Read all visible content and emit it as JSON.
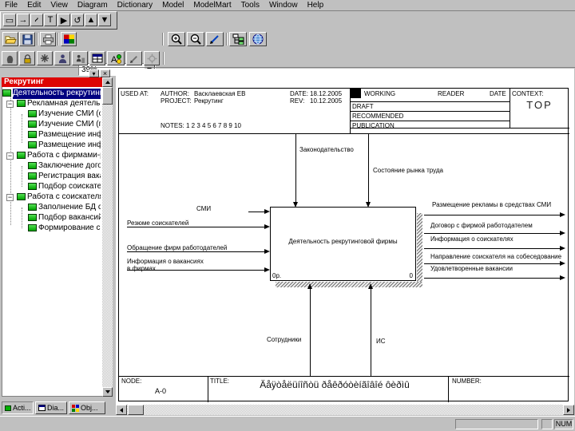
{
  "menu": {
    "items": [
      "File",
      "Edit",
      "View",
      "Diagram",
      "Dictionary",
      "Model",
      "ModelMart",
      "Tools",
      "Window",
      "Help"
    ]
  },
  "toolbars": {
    "tools": [
      "▭",
      "→",
      "~",
      "T",
      "▶",
      "↺",
      "▲",
      "▼"
    ],
    "zoom_value": "39%"
  },
  "explorer": {
    "title": "Рекрутинг",
    "panel_buttons": [
      "▾",
      "×"
    ],
    "tabs": [
      "Acti...",
      "Dia...",
      "Obj..."
    ],
    "tree": [
      "Деятельность рекрутингово",
      "Рекламная деятельность",
      "Изучение СМИ (офици",
      "Изучение СМИ (печат",
      "Размещение информа",
      "Размещение информа",
      "Работа с фирмами-рабо",
      "Заключение договоро",
      "Регистрация вакансий",
      "Подбор соискателей",
      "Работа с соискателями",
      "Заполнение БД соиск",
      "Подбор вакансий",
      "Формирование списк"
    ]
  },
  "diagram": {
    "header": {
      "used_at": "USED AT:",
      "author_label": "AUTHOR:",
      "author": "Васклаевская ЕВ",
      "project_label": "PROJECT:",
      "project": "Рекрутинг",
      "date_label": "DATE:",
      "date": "18.12.2005",
      "rev_label": "REV:",
      "rev": "10.12.2005",
      "notes": "NOTES:  1  2  3  4  5  6  7  8  9  10",
      "working": "WORKING",
      "reader": "READER",
      "date_col": "DATE",
      "draft": "DRAFT",
      "recommended": "RECOMMENDED",
      "publication": "PUBLICATION",
      "context_label": "CONTEXT:",
      "context": "TOP"
    },
    "box": {
      "title": "Деятельность рекрутинговой фирмы",
      "number": "0",
      "cost": "0р."
    },
    "controls": [
      "Законодательство",
      "Состояние рынка труда"
    ],
    "inputs": [
      "СМИ",
      "Резюме соискателей",
      "Обращение фирм работодателей",
      "Информация о вакансиях\nв фирмах"
    ],
    "outputs": [
      "Размещение рекламы в средствах СМИ",
      "Договор с фирмой работодателем",
      "Информация о соискателях",
      "Направление соискателя на собеседование",
      "Удовлетворенные вакансии"
    ],
    "mechanisms": [
      "Сотрудники",
      "ИС"
    ],
    "footer": {
      "node_label": "NODE:",
      "node": "A-0",
      "title_label": "TITLE:",
      "title": "Äåÿòåëüíîñòü ðåêðóòèíãîâîé ôèðìû",
      "number_label": "NUMBER:"
    }
  },
  "status": {
    "num": "NUM"
  }
}
